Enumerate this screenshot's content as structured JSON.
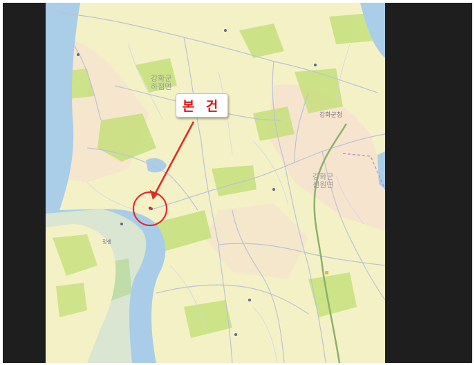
{
  "callout": {
    "text": "본 건"
  },
  "districts": {
    "hajeom": {
      "line1": "강화군",
      "line2": "하점면"
    },
    "seonwon": {
      "line1": "강화군",
      "line2": "선원면"
    }
  },
  "places": {
    "ganghwa_office": "강화군청",
    "jeongsaeng": "정생"
  },
  "colors": {
    "water": "#aacde8",
    "land": "#f4f1c7",
    "farmland": "#c6e07c",
    "urban": "#f7dcd3",
    "roads": "#b9c3d6",
    "marker": "#e22a2a",
    "railway": "#8ab16a",
    "background": "#1e1e1e"
  },
  "icons": [
    "pin-icon",
    "bus-icon",
    "red-circle-marker",
    "arrow"
  ]
}
